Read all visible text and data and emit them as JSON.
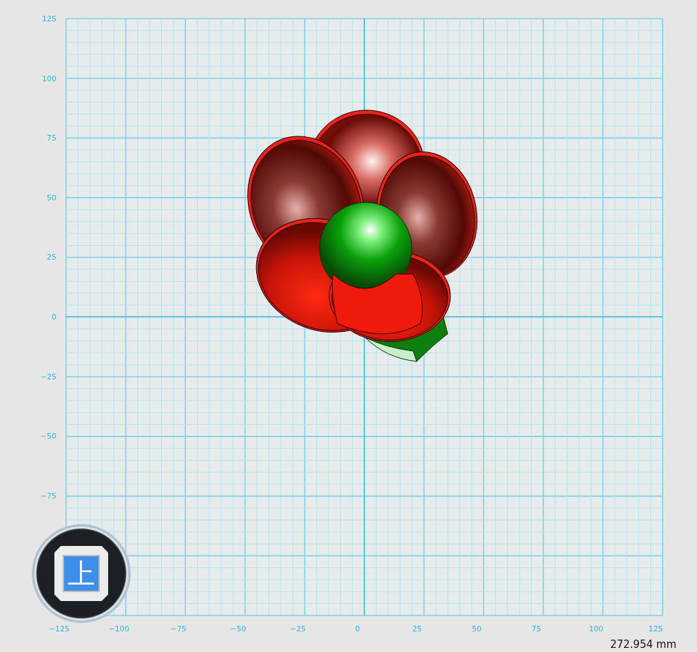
{
  "viewport": {
    "y_axis_labels": [
      "125",
      "100",
      "75",
      "50",
      "25",
      "0",
      "−25",
      "−50",
      "−75"
    ],
    "x_axis_labels": [
      "−125",
      "−100",
      "−75",
      "−50",
      "−25",
      "0",
      "25",
      "50",
      "75",
      "100",
      "125"
    ]
  },
  "view_cube": {
    "face_label": "上"
  },
  "status": {
    "scale": "272.954 mm"
  }
}
